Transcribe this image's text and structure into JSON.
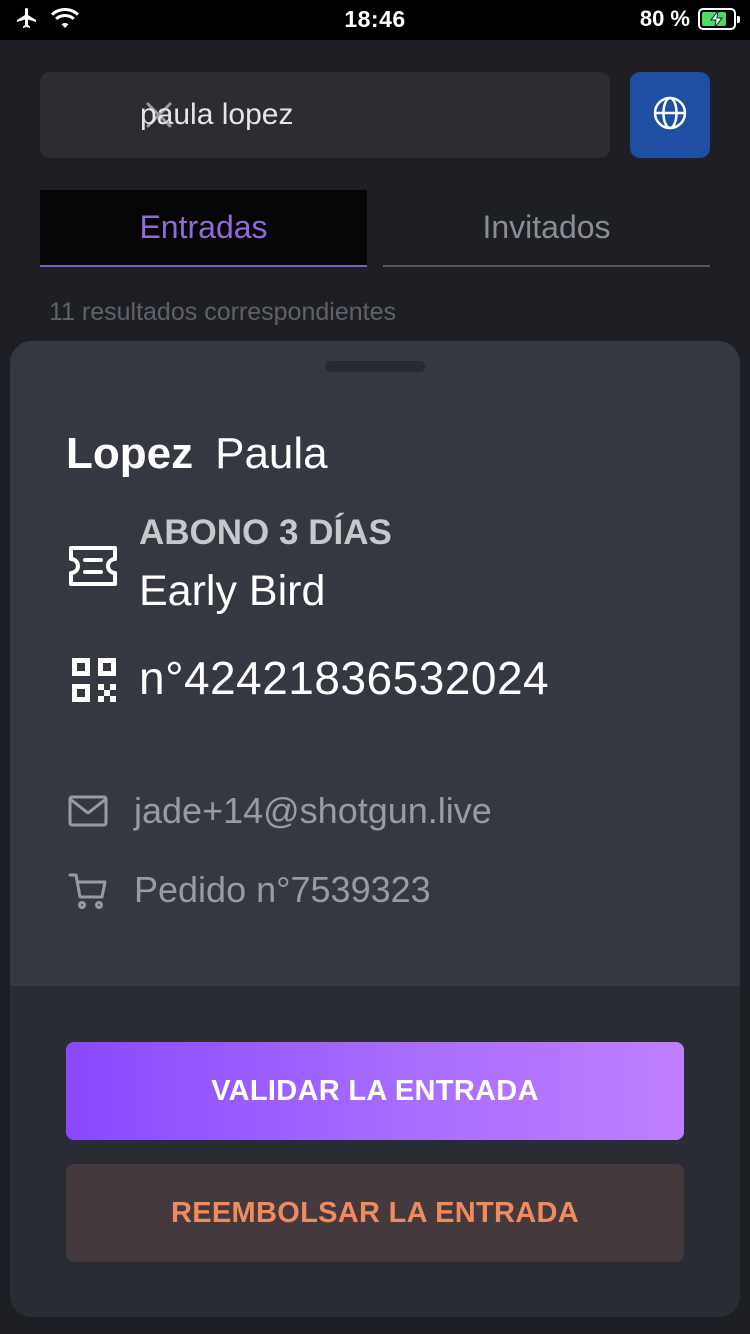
{
  "status_bar": {
    "time": "18:46",
    "battery_percent": "80 %",
    "battery_level": 0.8
  },
  "search": {
    "value": "paula lopez"
  },
  "tabs": [
    {
      "label": "Entradas",
      "active": true
    },
    {
      "label": "Invitados",
      "active": false
    }
  ],
  "results_count": "11 resultados correspondientes",
  "ticket": {
    "last_name": "Lopez",
    "first_name": "Paula",
    "type": "ABONO 3 DÍAS",
    "rate": "Early Bird",
    "number": "n°42421836532024",
    "email": "jade+14@shotgun.live",
    "order": "Pedido n°7539323"
  },
  "actions": {
    "validate_label": "VALIDAR LA ENTRADA",
    "refund_label": "REEMBOLSAR LA ENTRADA"
  },
  "colors": {
    "accent": "#8a48ff",
    "refund_text": "#f08b5f",
    "globe_button": "#1e4fa3"
  },
  "icons": [
    "airplane-icon",
    "wifi-icon",
    "battery-icon",
    "close-icon",
    "globe-icon",
    "ticket-icon",
    "qr-code-icon",
    "mail-icon",
    "cart-icon"
  ]
}
